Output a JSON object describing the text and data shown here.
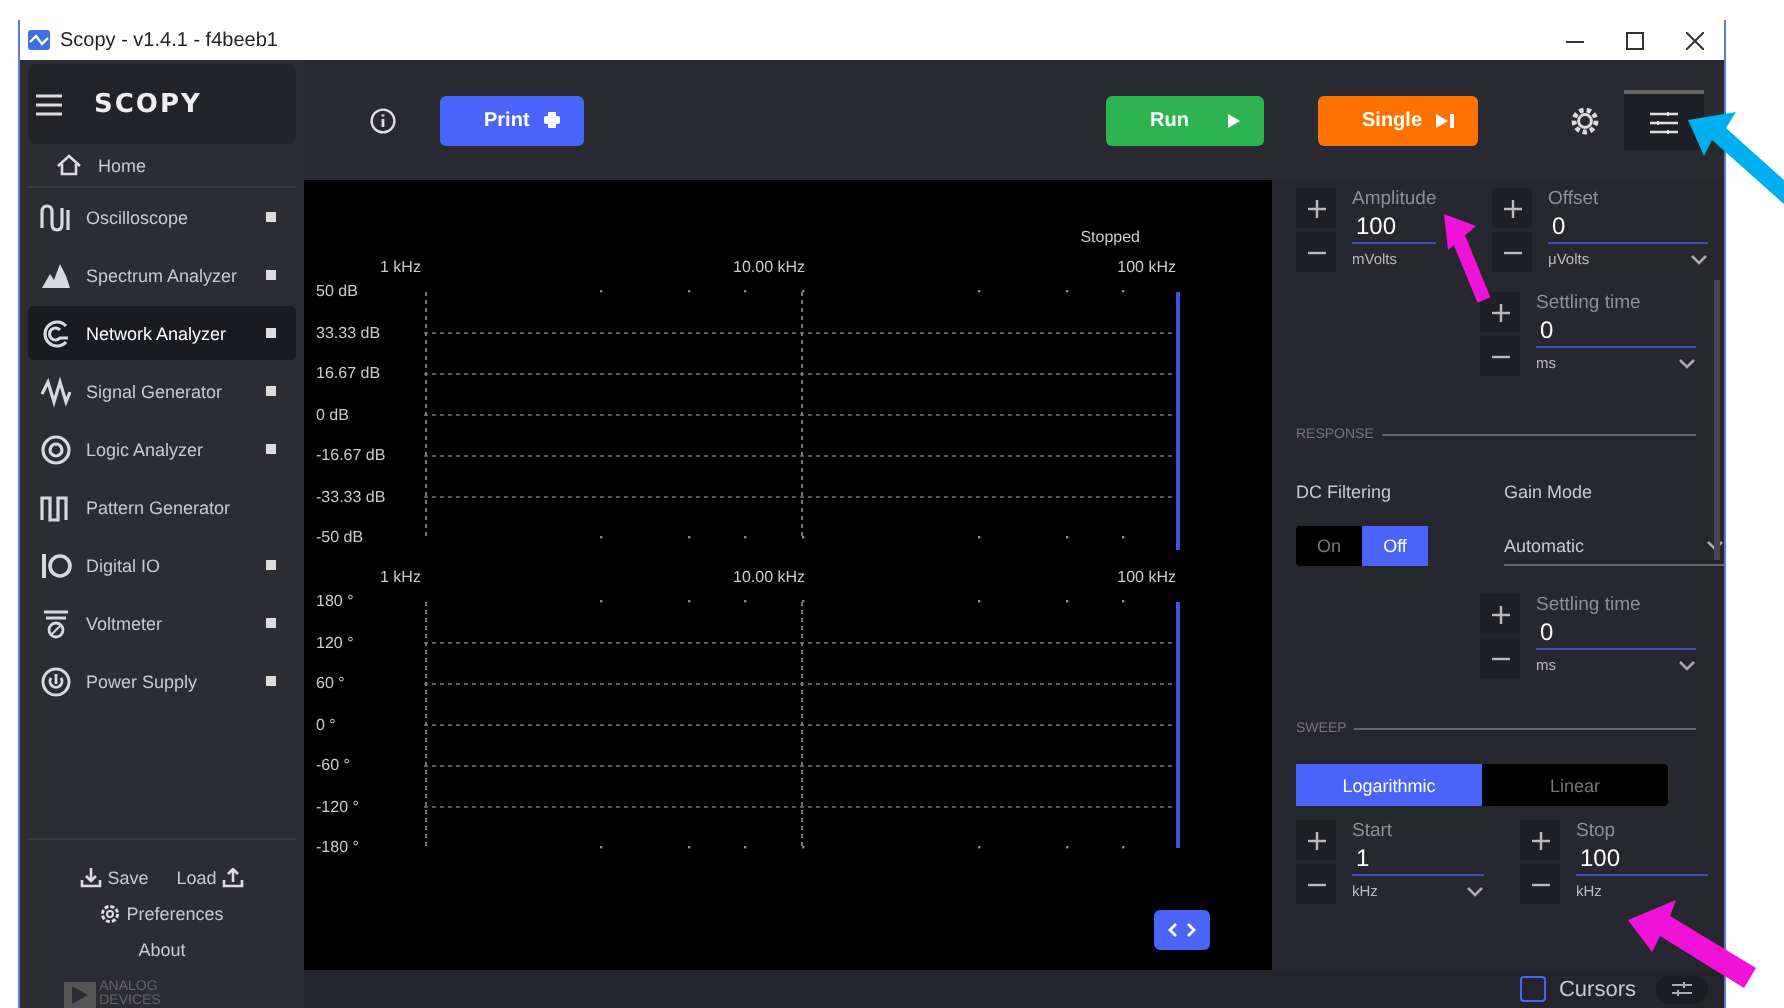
{
  "window": {
    "title": "Scopy - v1.4.1 - f4beeb1"
  },
  "sidebar": {
    "logo": "SCOPY",
    "home": "Home",
    "items": [
      {
        "label": "Oscilloscope",
        "selected": false,
        "indicator": true
      },
      {
        "label": "Spectrum Analyzer",
        "selected": false,
        "indicator": true
      },
      {
        "label": "Network Analyzer",
        "selected": true,
        "indicator": true
      },
      {
        "label": "Signal Generator",
        "selected": false,
        "indicator": true
      },
      {
        "label": "Logic Analyzer",
        "selected": false,
        "indicator": true
      },
      {
        "label": "Pattern Generator",
        "selected": false,
        "indicator": false
      },
      {
        "label": "Digital IO",
        "selected": false,
        "indicator": true
      },
      {
        "label": "Voltmeter",
        "selected": false,
        "indicator": true
      },
      {
        "label": "Power Supply",
        "selected": false,
        "indicator": true
      }
    ],
    "save": "Save",
    "load": "Load",
    "preferences": "Preferences",
    "about": "About",
    "brand": [
      "ANALOG",
      "DEVICES"
    ]
  },
  "toolbar": {
    "print": "Print",
    "run": "Run",
    "single": "Single",
    "menu_open": true
  },
  "plot": {
    "status": "Stopped",
    "magnitude": {
      "x_labels": [
        "1 kHz",
        "10.00 kHz",
        "100 kHz"
      ],
      "y_labels": [
        "50 dB",
        "33.33 dB",
        "16.67 dB",
        "0 dB",
        "-16.67 dB",
        "-33.33 dB",
        "-50 dB"
      ]
    },
    "phase": {
      "x_labels": [
        "1 kHz",
        "10.00 kHz",
        "100 kHz"
      ],
      "y_labels": [
        "180 °",
        "120 °",
        "60 °",
        "0 °",
        "-60 °",
        "-120 °",
        "-180 °"
      ]
    }
  },
  "panel": {
    "amplitude": {
      "label": "Amplitude",
      "value": "100",
      "unit": "mVolts",
      "dropdown": false
    },
    "offset": {
      "label": "Offset",
      "value": "0",
      "unit": "μVolts",
      "dropdown": true
    },
    "settling_time": {
      "label": "Settling time",
      "value": "0",
      "unit": "ms",
      "dropdown": true
    },
    "response": {
      "title": "RESPONSE",
      "dc_filtering": {
        "label": "DC Filtering",
        "options": [
          {
            "label": "On",
            "selected": false
          },
          {
            "label": "Off",
            "selected": true
          }
        ]
      },
      "gain_mode": {
        "label": "Gain Mode",
        "value": "Automatic"
      },
      "settling_time": {
        "label": "Settling time",
        "value": "0",
        "unit": "ms",
        "dropdown": true
      }
    },
    "sweep": {
      "title": "SWEEP",
      "scales": [
        {
          "label": "Logarithmic",
          "selected": true
        },
        {
          "label": "Linear",
          "selected": false
        }
      ],
      "start": {
        "label": "Start",
        "value": "1",
        "unit": "kHz",
        "dropdown": true
      },
      "stop": {
        "label": "Stop",
        "value": "100",
        "unit": "kHz",
        "dropdown": false
      }
    }
  },
  "status_bar": {
    "cursors": {
      "label": "Cursors",
      "checked": false
    }
  }
}
